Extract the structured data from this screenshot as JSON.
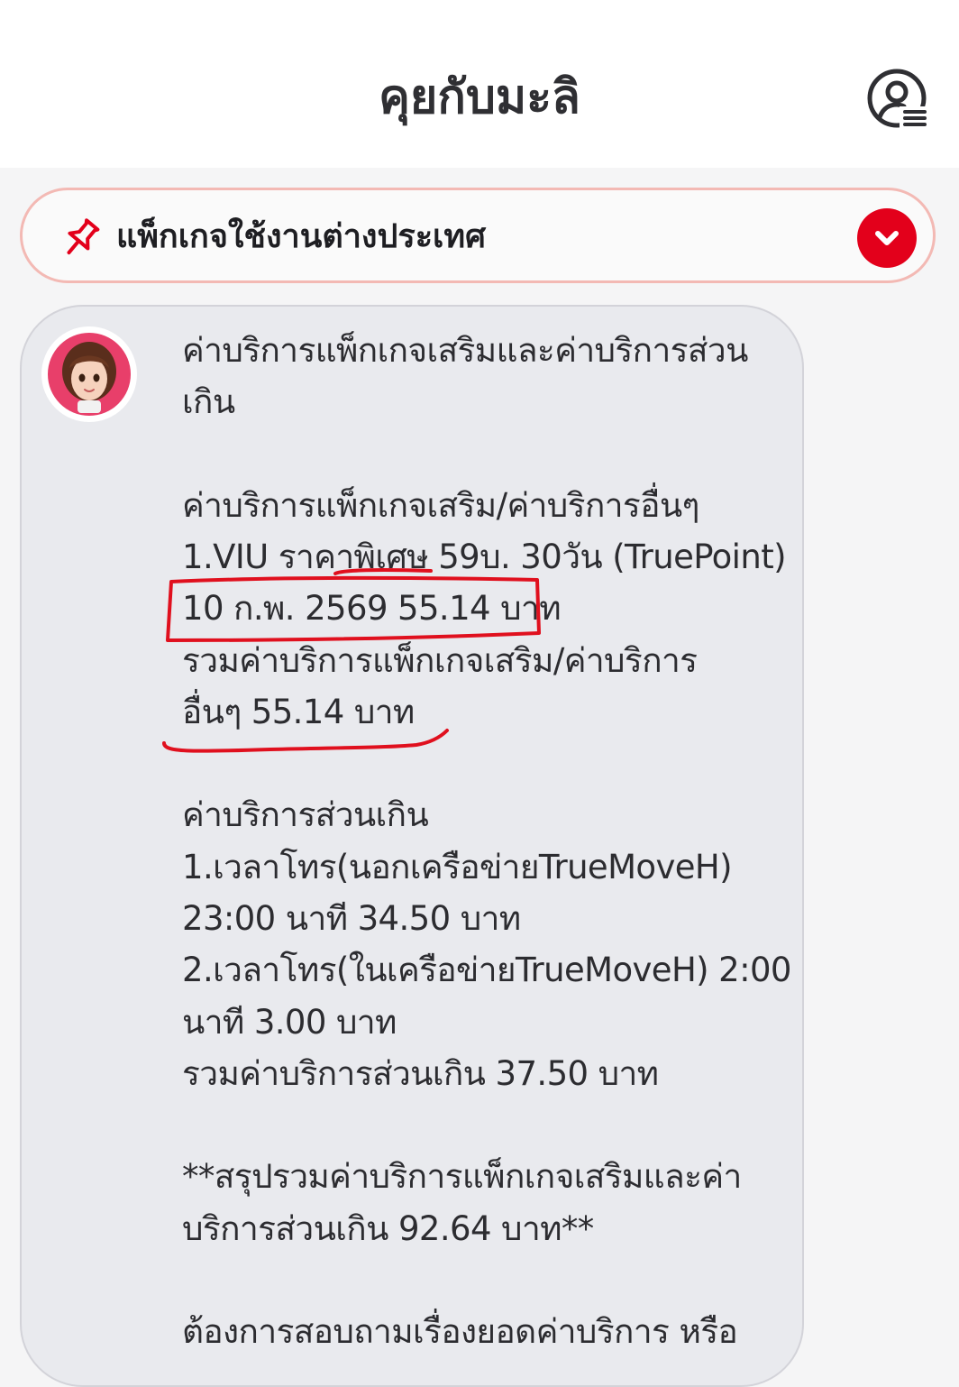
{
  "header": {
    "title": "คุยกับมะลิ",
    "profile_icon": "profile-menu-icon"
  },
  "pinned": {
    "icon": "pin-icon",
    "label": "แพ็กเกจใช้งานต่างประเทศ",
    "expand_icon": "chevron-down-icon",
    "accent_color": "#e3001b"
  },
  "message": {
    "avatar": "assistant-avatar",
    "lines": [
      "ค่าบริการแพ็กเกจเสริมและค่าบริการส่วน",
      "เกิน",
      "ค่าบริการแพ็กเกจเสริม/ค่าบริการอื่นๆ",
      "1.VIU ราคาพิเศษ 59บ. 30วัน (TruePoint)",
      "10 ก.พ. 2569 55.14 บาท",
      "รวมค่าบริการแพ็กเกจเสริม/ค่าบริการ",
      "อื่นๆ 55.14 บาท",
      "ค่าบริการส่วนเกิน",
      "1.เวลาโทร(นอกเครือข่ายTrueMoveH)",
      "23:00 นาที 34.50 บาท",
      "2.เวลาโทร(ในเครือข่ายTrueMoveH) 2:00",
      "นาที 3.00 บาท",
      "รวมค่าบริการส่วนเกิน 37.50 บาท",
      "**สรุปรวมค่าบริการแพ็กเกจเสริมและค่า",
      "บริการส่วนเกิน 92.64 บาท**",
      "ต้องการสอบถามเรื่องยอดค่าบริการ หรือ"
    ]
  },
  "annotations": {
    "color": "#e0101e"
  }
}
